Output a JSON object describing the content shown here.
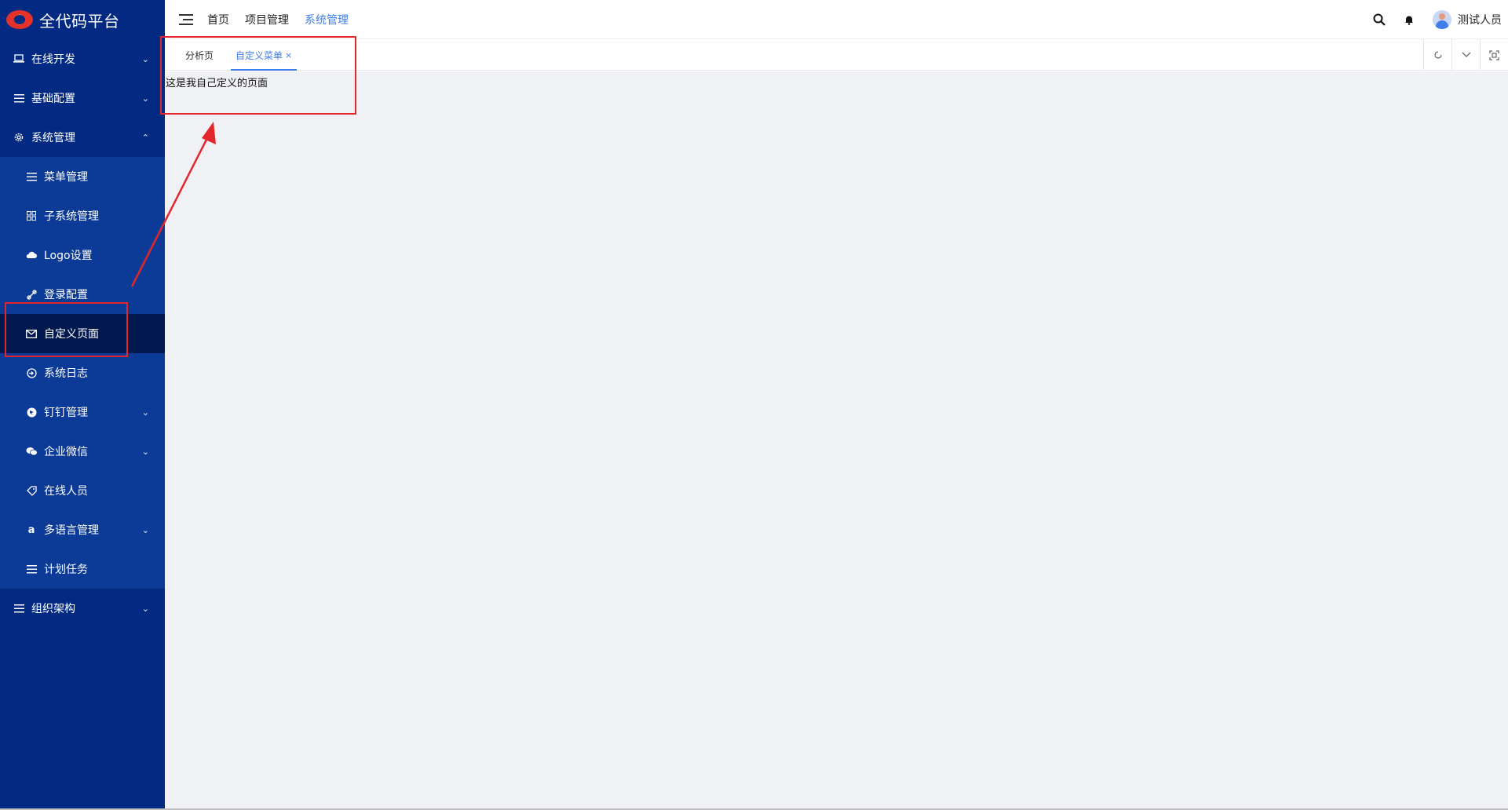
{
  "app": {
    "title": "全代码平台"
  },
  "sidebar": {
    "items": [
      {
        "label": "在线开发",
        "icon": "laptop-icon",
        "chevron": "⌄"
      },
      {
        "label": "基础配置",
        "icon": "list-icon",
        "chevron": "⌄"
      },
      {
        "label": "系统管理",
        "icon": "gear-icon",
        "chevron": "⌃"
      }
    ],
    "submenu": [
      {
        "label": "菜单管理",
        "icon": "list-icon"
      },
      {
        "label": "子系统管理",
        "icon": "grid-icon"
      },
      {
        "label": "Logo设置",
        "icon": "cloud-icon"
      },
      {
        "label": "登录配置",
        "icon": "link-icon"
      },
      {
        "label": "自定义页面",
        "icon": "mail-icon"
      },
      {
        "label": "系统日志",
        "icon": "login-icon"
      },
      {
        "label": "钉钉管理",
        "icon": "dingtalk-icon",
        "chevron": "⌄"
      },
      {
        "label": "企业微信",
        "icon": "wechat-icon",
        "chevron": "⌄"
      },
      {
        "label": "在线人员",
        "icon": "tag-icon"
      },
      {
        "label": "多语言管理",
        "icon": "amazon-icon",
        "chevron": "⌄"
      },
      {
        "label": "计划任务",
        "icon": "list-icon"
      }
    ],
    "after": [
      {
        "label": "组织架构",
        "icon": "list-icon",
        "chevron": "⌄"
      }
    ]
  },
  "header": {
    "nav": [
      {
        "label": "首页"
      },
      {
        "label": "项目管理"
      },
      {
        "label": "系统管理"
      }
    ],
    "user_name": "测试人员"
  },
  "tabs": {
    "items": [
      {
        "label": "分析页"
      },
      {
        "label": "自定义菜单",
        "close": "×"
      }
    ]
  },
  "content": {
    "text": "这是我自己定义的页面"
  },
  "colors": {
    "sidebar_bg": "#022a83",
    "submenu_bg": "#0b3a97",
    "active_bg": "#01194f",
    "accent": "#3f7de8",
    "annotation": "#e3262b"
  }
}
